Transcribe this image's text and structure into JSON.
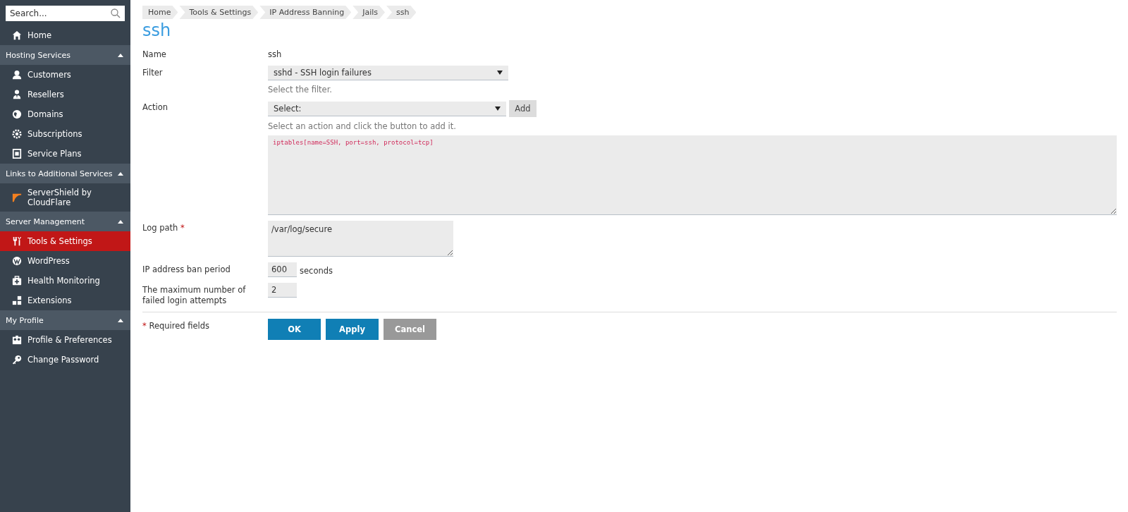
{
  "sidebar": {
    "search": {
      "placeholder": "Search..."
    },
    "items": [
      {
        "kind": "item",
        "label": "Home",
        "selected": false
      },
      {
        "kind": "section",
        "label": "Hosting Services",
        "expanded": true
      },
      {
        "kind": "item",
        "label": "Customers",
        "selected": false
      },
      {
        "kind": "item",
        "label": "Resellers",
        "selected": false
      },
      {
        "kind": "item",
        "label": "Domains",
        "selected": false
      },
      {
        "kind": "item",
        "label": "Subscriptions",
        "selected": false
      },
      {
        "kind": "item",
        "label": "Service Plans",
        "selected": false
      },
      {
        "kind": "section",
        "label": "Links to Additional Services",
        "expanded": true
      },
      {
        "kind": "item",
        "label": "ServerShield by CloudFlare",
        "selected": false
      },
      {
        "kind": "section",
        "label": "Server Management",
        "expanded": true
      },
      {
        "kind": "item",
        "label": "Tools & Settings",
        "selected": true
      },
      {
        "kind": "item",
        "label": "WordPress",
        "selected": false
      },
      {
        "kind": "item",
        "label": "Health Monitoring",
        "selected": false
      },
      {
        "kind": "item",
        "label": "Extensions",
        "selected": false
      },
      {
        "kind": "section",
        "label": "My Profile",
        "expanded": true
      },
      {
        "kind": "item",
        "label": "Profile & Preferences",
        "selected": false
      },
      {
        "kind": "item",
        "label": "Change Password",
        "selected": false
      }
    ]
  },
  "breadcrumbs": [
    "Home",
    "Tools & Settings",
    "IP Address Banning",
    "Jails",
    "ssh"
  ],
  "title": "ssh",
  "form": {
    "name": {
      "label": "Name",
      "value": "ssh"
    },
    "filter": {
      "label": "Filter",
      "value": "sshd - SSH login failures",
      "hint": "Select the filter."
    },
    "action": {
      "label": "Action",
      "value": "Select:",
      "button": "Add",
      "hint": "Select an action and click the button to add it.",
      "actions_text": "iptables[name=SSH, port=ssh, protocol=tcp]"
    },
    "log_path": {
      "label": "Log path",
      "required_mark": "*",
      "value": "/var/log/secure"
    },
    "ban_period": {
      "label": "IP address ban period",
      "value": "600",
      "unit": "seconds"
    },
    "max_attempts": {
      "label": "The maximum number of failed login attempts",
      "value": "2"
    },
    "required_note": {
      "mark": "*",
      "text": "Required fields"
    },
    "buttons": [
      {
        "label": "OK",
        "kind": "primary"
      },
      {
        "label": "Apply",
        "kind": "primary"
      },
      {
        "label": "Cancel",
        "kind": "secondary"
      }
    ]
  }
}
